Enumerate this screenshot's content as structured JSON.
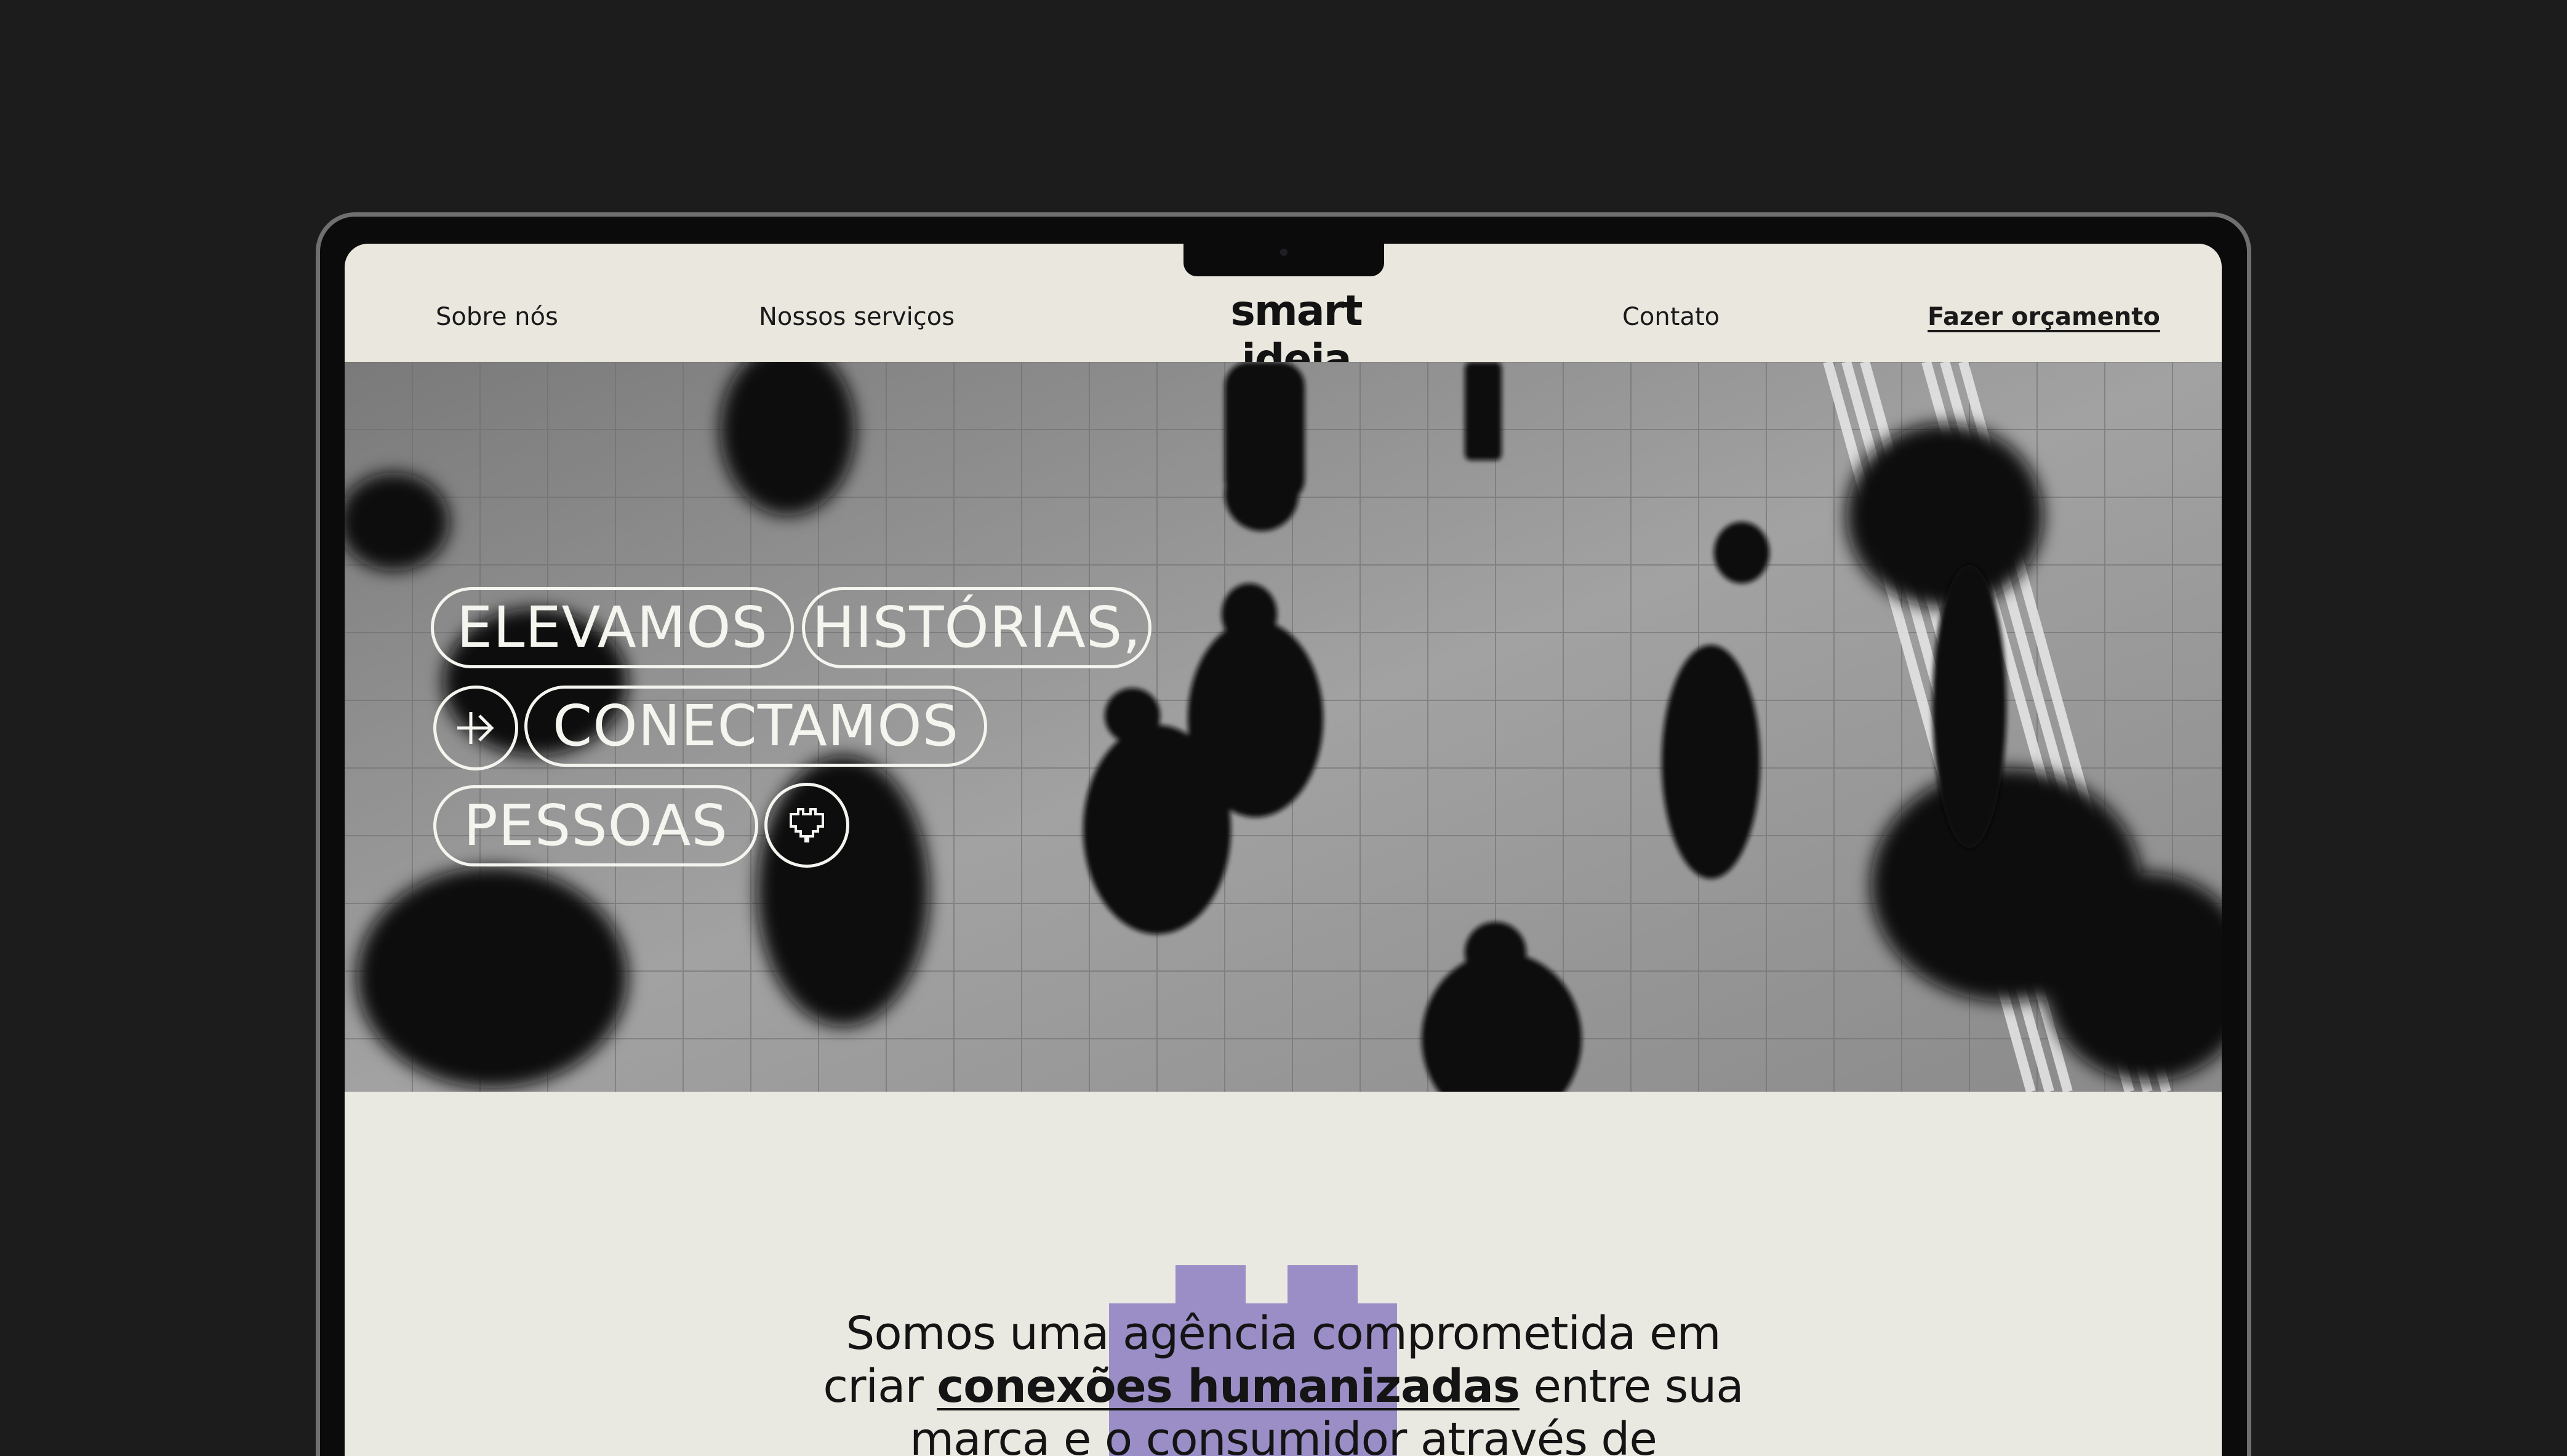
{
  "nav": {
    "about": "Sobre nós",
    "services": "Nossos serviços",
    "logo": "smart ideia",
    "contact": "Contato",
    "quote": "Fazer orçamento"
  },
  "hero": {
    "pill_1": "ELEVAMOS",
    "pill_2": "HISTÓRIAS,",
    "pill_3": "CONECTAMOS",
    "pill_4": "PESSOAS",
    "arrow_icon": "arrow-right-icon",
    "heart_icon": "pixel-heart-icon"
  },
  "intro": {
    "line1": "Somos uma agência comprometida em",
    "line2_start": "criar ",
    "line2_bold": "conexões humanizadas",
    "line2_end": " entre sua",
    "line3": "marca e o consumidor através de",
    "accent_color": "#9b8ec7"
  },
  "colors": {
    "background": "#1c1c1c",
    "page": "#e9e7de",
    "text": "#141414",
    "hero_text": "#f5f5f0"
  }
}
